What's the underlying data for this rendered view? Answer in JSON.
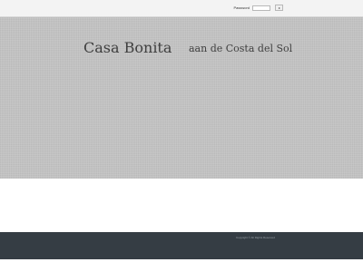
{
  "topbar": {
    "password_label": "Password",
    "password_value": ""
  },
  "header": {
    "title": "Casa Bonita",
    "subtitle": "aan de Costa del Sol"
  },
  "footer": {
    "copyright": "Copyright © All Rights Reserved"
  },
  "icons": {
    "login_button_icon": "chevron-right-icon"
  },
  "colors": {
    "hero_background": "#c2c2c2",
    "footer_background": "#353d44",
    "title_text": "#3f3f3f"
  }
}
